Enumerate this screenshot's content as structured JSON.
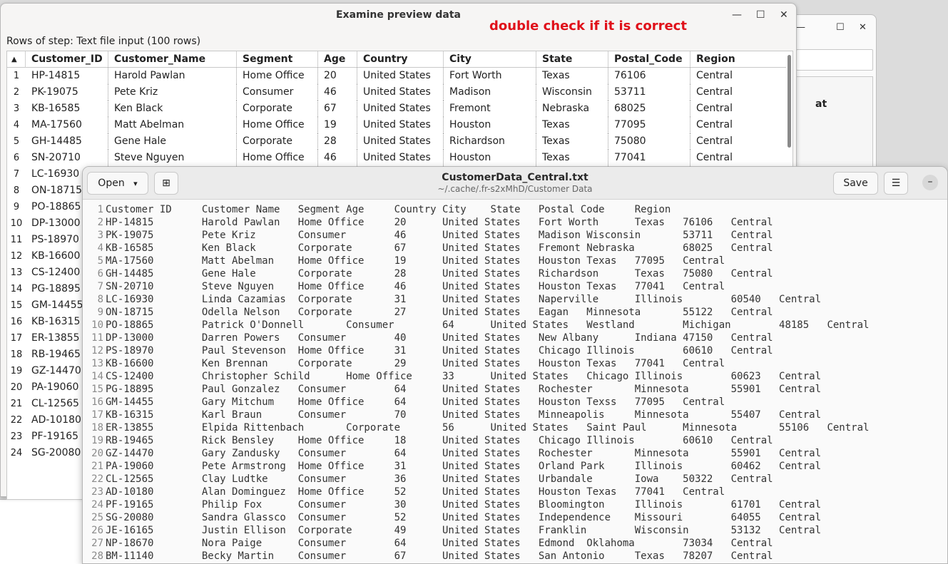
{
  "preview": {
    "title": "Examine preview data",
    "note": "double check if it is correct",
    "rows_info": "Rows of step: Text file input (100 rows)",
    "min_icon": "minimize-icon",
    "columns": [
      "Customer_ID",
      "Customer_Name",
      "Segment",
      "Age",
      "Country",
      "City",
      "State",
      "Postal_Code",
      "Region"
    ],
    "rows": [
      [
        "1",
        "HP-14815",
        "Harold Pawlan",
        "Home Office",
        "20",
        "United States",
        "Fort Worth",
        "Texas",
        "76106",
        "Central"
      ],
      [
        "2",
        "PK-19075",
        "Pete Kriz",
        "Consumer",
        "46",
        "United States",
        "Madison",
        "Wisconsin",
        "53711",
        "Central"
      ],
      [
        "3",
        "KB-16585",
        "Ken Black",
        "Corporate",
        "67",
        "United States",
        "Fremont",
        "Nebraska",
        "68025",
        "Central"
      ],
      [
        "4",
        "MA-17560",
        "Matt Abelman",
        "Home Office",
        "19",
        "United States",
        "Houston",
        "Texas",
        "77095",
        "Central"
      ],
      [
        "5",
        "GH-14485",
        "Gene Hale",
        "Corporate",
        "28",
        "United States",
        "Richardson",
        "Texas",
        "75080",
        "Central"
      ],
      [
        "6",
        "SN-20710",
        "Steve Nguyen",
        "Home Office",
        "46",
        "United States",
        "Houston",
        "Texas",
        "77041",
        "Central"
      ],
      [
        "7",
        "LC-16930"
      ],
      [
        "8",
        "ON-18715"
      ],
      [
        "9",
        "PO-18865"
      ],
      [
        "10",
        "DP-13000"
      ],
      [
        "11",
        "PS-18970"
      ],
      [
        "12",
        "KB-16600"
      ],
      [
        "13",
        "CS-12400"
      ],
      [
        "14",
        "PG-18895"
      ],
      [
        "15",
        "GM-14455"
      ],
      [
        "16",
        "KB-16315"
      ],
      [
        "17",
        "ER-13855"
      ],
      [
        "18",
        "RB-19465"
      ],
      [
        "19",
        "GZ-14470"
      ],
      [
        "20",
        "PA-19060"
      ],
      [
        "21",
        "CL-12565"
      ],
      [
        "22",
        "AD-10180"
      ],
      [
        "23",
        "PF-19165"
      ],
      [
        "24",
        "SG-20080"
      ]
    ]
  },
  "bg_window": {
    "label": "at"
  },
  "editor": {
    "open_label": "Open",
    "title": "CustomerData_Central.txt",
    "path": "~/.cache/.fr-s2xMhD/Customer Data",
    "save_label": "Save",
    "lines": [
      "Customer ID     Customer Name   Segment Age     Country City    State   Postal Code     Region",
      "HP-14815        Harold Pawlan   Home Office     20      United States   Fort Worth      Texas   76106   Central",
      "PK-19075        Pete Kriz       Consumer        46      United States   Madison Wisconsin       53711   Central",
      "KB-16585        Ken Black       Corporate       67      United States   Fremont Nebraska        68025   Central",
      "MA-17560        Matt Abelman    Home Office     19      United States   Houston Texas   77095   Central",
      "GH-14485        Gene Hale       Corporate       28      United States   Richardson      Texas   75080   Central",
      "SN-20710        Steve Nguyen    Home Office     46      United States   Houston Texas   77041   Central",
      "LC-16930        Linda Cazamias  Corporate       31      United States   Naperville      Illinois        60540   Central",
      "ON-18715        Odella Nelson   Corporate       27      United States   Eagan   Minnesota       55122   Central",
      "PO-18865        Patrick O'Donnell       Consumer        64      United States   Westland        Michigan        48185   Central",
      "DP-13000        Darren Powers   Consumer        40      United States   New Albany      Indiana 47150   Central",
      "PS-18970        Paul Stevenson  Home Office     31      United States   Chicago Illinois        60610   Central",
      "KB-16600        Ken Brennan     Corporate       29      United States   Houston Texas   77041   Central",
      "CS-12400        Christopher Schild      Home Office     33      United States   Chicago Illinois        60623   Central",
      "PG-18895        Paul Gonzalez   Consumer        64      United States   Rochester       Minnesota       55901   Central",
      "GM-14455        Gary Mitchum    Home Office     64      United States   Houston Texss   77095   Central",
      "KB-16315        Karl Braun      Consumer        70      United States   Minneapolis     Minnesota       55407   Central",
      "ER-13855        Elpida Rittenbach       Corporate       56      United States   Saint Paul      Minnesota       55106   Central",
      "RB-19465        Rick Bensley    Home Office     18      United States   Chicago Illinois        60610   Central",
      "GZ-14470        Gary Zandusky   Consumer        64      United States   Rochester       Minnesota       55901   Central",
      "PA-19060        Pete Armstrong  Home Office     31      United States   Orland Park     Illinois        60462   Central",
      "CL-12565        Clay Ludtke     Consumer        36      United States   Urbandale       Iowa    50322   Central",
      "AD-10180        Alan Dominguez  Home Office     52      United States   Houston Texas   77041   Central",
      "PF-19165        Philip Fox      Consumer        30      United States   Bloomington     Illinois        61701   Central",
      "SG-20080        Sandra Glassco  Consumer        52      United States   Independence    Missouri        64055   Central",
      "JE-16165        Justin Ellison  Corporate       49      United States   Franklin        Wisconsin       53132   Central",
      "NP-18670        Nora Paige      Consumer        64      United States   Edmond  Oklahoma        73034   Central",
      "BM-11140        Becky Martin    Consumer        67      United States   San Antonio     Texas   78207   Central"
    ]
  }
}
